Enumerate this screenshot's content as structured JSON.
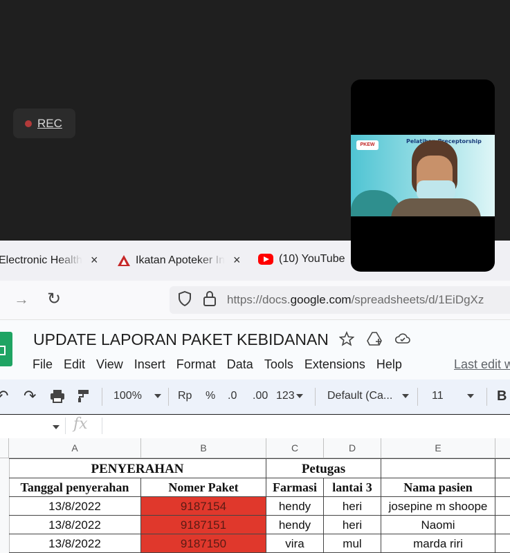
{
  "meeting": {
    "rec_label": "REC",
    "video_slide_title": "Pelatihan Preceptorship",
    "video_slide_logo": "PKEW"
  },
  "tabs": [
    {
      "label": "Electronic Health",
      "close": "×"
    },
    {
      "label": "Ikatan Apoteker In",
      "close": "×"
    },
    {
      "label": "(10) YouTube",
      "close": "×"
    }
  ],
  "nav": {
    "url_domain_prefix": "https://docs.",
    "url_domain": "google.com",
    "url_path": "/spreadsheets/d/1EiDgXz"
  },
  "doc": {
    "title": "UPDATE LAPORAN PAKET KEBIDANAN",
    "menu": [
      "File",
      "Edit",
      "View",
      "Insert",
      "Format",
      "Data",
      "Tools",
      "Extensions",
      "Help"
    ],
    "last_edit": "Last edit w"
  },
  "toolbar": {
    "zoom": "100%",
    "currency": "Rp",
    "percent": "%",
    "dec_decrease": ".0",
    "dec_increase": ".00",
    "number_format": "123",
    "font": "Default (Ca...",
    "font_size": "11",
    "bold": "B"
  },
  "formula": {
    "fx": "fx"
  },
  "sheet": {
    "columns": [
      "A",
      "B",
      "C",
      "D",
      "E"
    ],
    "header1": {
      "penyerahan": "PENYERAHAN",
      "petugas": "Petugas"
    },
    "header2": [
      "Tanggal penyerahan",
      "Nomer Paket",
      "Farmasi",
      "lantai 3",
      "Nama pasien"
    ],
    "rows": [
      [
        "13/8/2022",
        "9187154",
        "hendy",
        "heri",
        "josepine m shoope"
      ],
      [
        "13/8/2022",
        "9187151",
        "hendy",
        "heri",
        "Naomi"
      ],
      [
        "13/8/2022",
        "9187150",
        "vira",
        "mul",
        "marda riri"
      ]
    ]
  },
  "colors": {
    "highlight_red": "#e0382c",
    "sheets_green": "#1fa463"
  }
}
